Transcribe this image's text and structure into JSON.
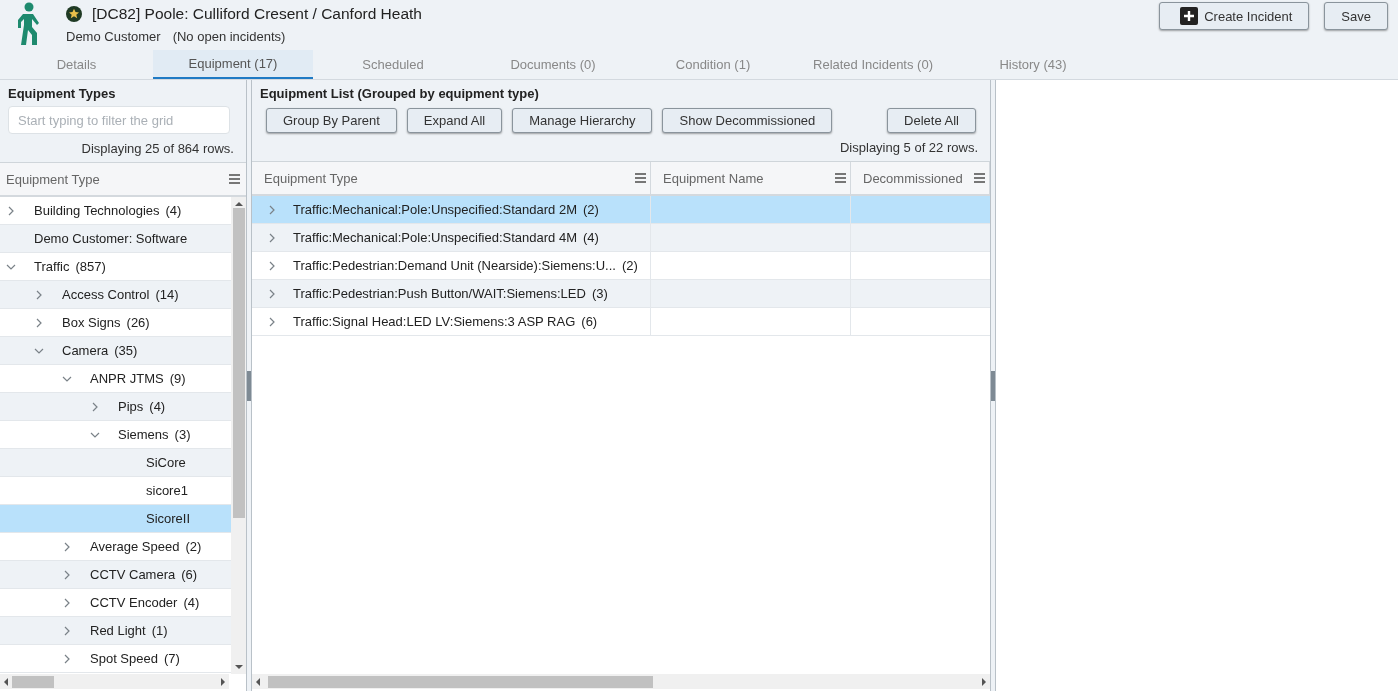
{
  "header": {
    "title": "[DC82] Poole: Culliford Cresent / Canford Heath",
    "customer": "Demo Customer",
    "incidents": "(No open incidents)",
    "buttons": [
      {
        "kind": "create",
        "label": "Create Incident"
      },
      {
        "kind": "plain",
        "label": "Save"
      }
    ]
  },
  "tabs": [
    {
      "label": "Details",
      "selected": false
    },
    {
      "label": "Equipment (17)",
      "selected": true
    },
    {
      "label": "Scheduled",
      "selected": false
    },
    {
      "label": "Documents (0)",
      "selected": false
    },
    {
      "label": "Condition (1)",
      "selected": false
    },
    {
      "label": "Related Incidents (0)",
      "selected": false
    },
    {
      "label": "History (43)",
      "selected": false
    }
  ],
  "equipment_types": {
    "title": "Equipment Types",
    "filter": {
      "placeholder": "Start typing to filter the grid"
    },
    "row_count": "Displaying 25 of 864 rows.",
    "column": "Equipment Type",
    "tree": [
      {
        "label": "Building Technologies",
        "count": "(4)",
        "expanded": false,
        "selected": false
      },
      {
        "label": "Demo Customer: Software",
        "selected": false
      },
      {
        "label": "Traffic",
        "count": "(857)",
        "expanded": true,
        "selected": false,
        "children": [
          {
            "label": "Access Control",
            "count": "(14)",
            "expanded": false,
            "selected": false
          },
          {
            "label": "Box Signs",
            "count": "(26)",
            "expanded": false,
            "selected": false
          },
          {
            "label": "Camera",
            "count": "(35)",
            "expanded": true,
            "selected": false,
            "children": [
              {
                "label": "ANPR JTMS",
                "count": "(9)",
                "expanded": true,
                "selected": false,
                "children": [
                  {
                    "label": "Pips",
                    "count": "(4)",
                    "expanded": false,
                    "selected": false
                  },
                  {
                    "label": "Siemens",
                    "count": "(3)",
                    "expanded": true,
                    "selected": false,
                    "children": [
                      {
                        "label": "SiCore",
                        "selected": false
                      },
                      {
                        "label": "sicore1",
                        "selected": false
                      },
                      {
                        "label": "SicoreII",
                        "selected": true
                      }
                    ]
                  }
                ]
              },
              {
                "label": "Average Speed",
                "count": "(2)",
                "expanded": false,
                "selected": false
              },
              {
                "label": "CCTV Camera",
                "count": "(6)",
                "expanded": false,
                "selected": false
              },
              {
                "label": "CCTV Encoder",
                "count": "(4)",
                "expanded": false,
                "selected": false
              },
              {
                "label": "Red Light",
                "count": "(1)",
                "expanded": false,
                "selected": false
              },
              {
                "label": "Spot Speed",
                "count": "(7)",
                "expanded": false,
                "selected": false
              }
            ]
          }
        ]
      }
    ]
  },
  "equipment_list": {
    "title": "Equipment List (Grouped by equipment type)",
    "buttons": [
      "Group By Parent",
      "Expand All",
      "Manage Hierarchy",
      "Show Decommissioned"
    ],
    "delete_button": "Delete All",
    "row_count": "Displaying 5 of 22 rows.",
    "columns": [
      "Equipment Type",
      "Equipment Name",
      "Decommissioned"
    ],
    "rows": [
      {
        "type": "Traffic:Mechanical:Pole:Unspecified:Standard 2M",
        "count": "(2)",
        "expanded": false,
        "selected": true
      },
      {
        "type": "Traffic:Mechanical:Pole:Unspecified:Standard 4M",
        "count": "(4)",
        "expanded": false,
        "selected": false
      },
      {
        "type": "Traffic:Pedestrian:Demand Unit (Nearside):Siemens:U...",
        "count": "(2)",
        "expanded": false,
        "selected": false
      },
      {
        "type": "Traffic:Pedestrian:Push Button/WAIT:Siemens:LED",
        "count": "(3)",
        "expanded": false,
        "selected": false
      },
      {
        "type": "Traffic:Signal Head:LED LV:Siemens:3 ASP RAG",
        "count": "(6)",
        "expanded": false,
        "selected": false
      }
    ]
  }
}
